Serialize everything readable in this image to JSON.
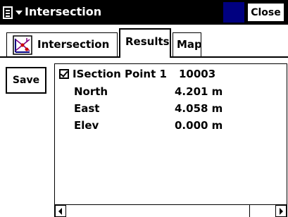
{
  "window": {
    "title": "Intersection",
    "close_label": "Close",
    "accent_color": "#000080",
    "titlebar_color": "#000000"
  },
  "tabs": [
    {
      "label": "Intersection",
      "icon": "intersection-diagram-icon",
      "active": false
    },
    {
      "label": "Results",
      "active": true
    },
    {
      "label": "Map",
      "active": false
    }
  ],
  "toolbar": {
    "save_label": "Save"
  },
  "result": {
    "checked": true,
    "point_name": "ISection Point 1",
    "point_id": "10003",
    "rows": [
      {
        "label": "North",
        "value": "4.201 m"
      },
      {
        "label": "East",
        "value": "4.058 m"
      },
      {
        "label": "Elev",
        "value": "0.000 m"
      }
    ]
  }
}
